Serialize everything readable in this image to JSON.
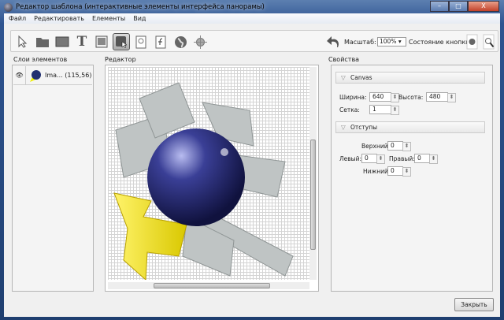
{
  "window": {
    "title": "Редактор шаблона (интерактивные элементы интерфейса панорамы)",
    "min": "–",
    "max": "□",
    "close": "X"
  },
  "menu": [
    "Файл",
    "Редактировать",
    "Елементы",
    "Вид"
  ],
  "toolbar": {
    "zoom_label": "Масштаб:",
    "zoom_value": "100% ▾",
    "state_label": "Состояние кнопки:"
  },
  "panels": {
    "layers": "Слои элементов",
    "editor": "Редактор",
    "props": "Свойства"
  },
  "layers": [
    {
      "name": "Ima... (115,56)"
    }
  ],
  "props": {
    "canvas_section": "Canvas",
    "width_label": "Ширина:",
    "width": "640",
    "height_label": "Высота:",
    "height": "480",
    "grid_label": "Сетка:",
    "grid": "1",
    "margins_section": "Отступы",
    "top_label": "Верхний:",
    "top": "0",
    "left_label": "Левый:",
    "left": "0",
    "right_label": "Правый:",
    "right": "0",
    "bottom_label": "Нижний:",
    "bottom": "0"
  },
  "close_button": "Закрыть"
}
